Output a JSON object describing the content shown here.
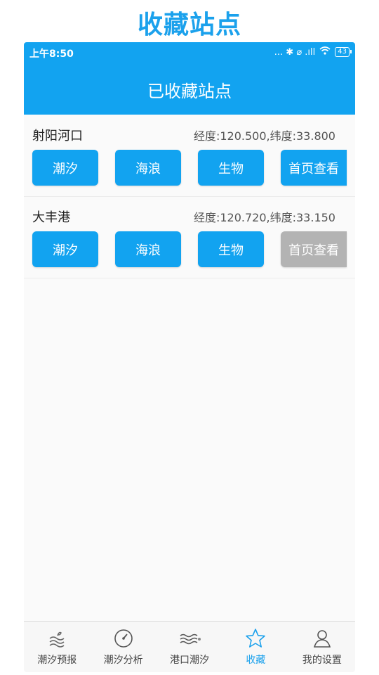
{
  "screen_title": "收藏站点",
  "status_bar": {
    "time": "上午8:50",
    "icons_text": "... ✱ ⌀ .ıll",
    "battery": "43"
  },
  "app_bar": {
    "title": "已收藏站点"
  },
  "stations": [
    {
      "name": "射阳河口",
      "coords": "经度:120.500,纬度:33.800",
      "buttons": [
        "潮汐",
        "海浪",
        "生物",
        "首页查看"
      ]
    },
    {
      "name": "大丰港",
      "coords": "经度:120.720,纬度:33.150",
      "buttons": [
        "潮汐",
        "海浪",
        "生物",
        "首页查看"
      ]
    }
  ],
  "tabbar": {
    "items": [
      {
        "label": "潮汐预报",
        "icon": "waves-icon"
      },
      {
        "label": "潮汐分析",
        "icon": "gauge-icon"
      },
      {
        "label": "港口潮汐",
        "icon": "harbor-waves-icon"
      },
      {
        "label": "收藏",
        "icon": "star-icon"
      },
      {
        "label": "我的设置",
        "icon": "user-icon"
      }
    ],
    "active_index": 3
  },
  "colors": {
    "accent": "#12a3f0",
    "inactive_button": "#b3b3b3",
    "title": "#1ba1ec"
  }
}
